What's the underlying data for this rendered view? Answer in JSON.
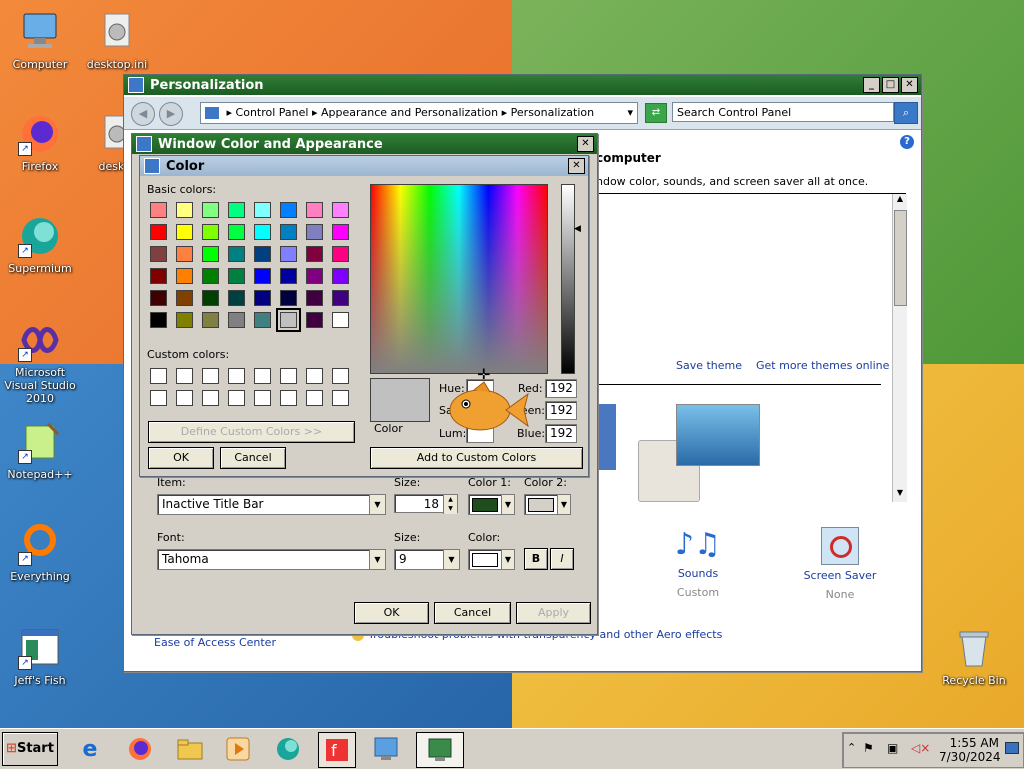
{
  "desktop": {
    "icons": [
      {
        "label": "Computer"
      },
      {
        "label": "desktop.ini"
      },
      {
        "label": "Firefox"
      },
      {
        "label": "deskto"
      },
      {
        "label": "Supermium"
      },
      {
        "label": "Microsoft Visual Studio 2010"
      },
      {
        "label": "Notepad++"
      },
      {
        "label": "Everything"
      },
      {
        "label": "Jeff's Fish"
      },
      {
        "label": "Recycle Bin"
      }
    ]
  },
  "personalization": {
    "title": "Personalization",
    "breadcrumb": [
      "Control Panel",
      "Appearance and Personalization",
      "Personalization"
    ],
    "search_placeholder": "Search Control Panel",
    "heading": "computer",
    "subtext": "ndow color, sounds, and screen saver all at once.",
    "save_theme": "Save theme",
    "get_more_themes": "Get more themes online",
    "sounds_label": "Sounds",
    "sounds_value": "Custom",
    "screensaver_label": "Screen Saver",
    "screensaver_value": "None",
    "ease_of_access": "Ease of Access Center",
    "troubleshoot": "Troubleshoot problems with transparency and other Aero effects"
  },
  "wca": {
    "title": "Window Color and Appearance",
    "item_label": "Item:",
    "item_value": "Inactive Title Bar",
    "size_label": "Size:",
    "size_value": "18",
    "color1_label": "Color 1:",
    "color2_label": "Color 2:",
    "color1": "#1e4d1e",
    "color2": "#d4d0c8",
    "font_label": "Font:",
    "font_value": "Tahoma",
    "font_size_label": "Size:",
    "font_size_value": "9",
    "font_color_label": "Color:",
    "font_color": "#ffffff",
    "bold_label": "B",
    "italic_label": "I",
    "ok": "OK",
    "cancel": "Cancel",
    "apply": "Apply"
  },
  "color_dialog": {
    "title": "Color",
    "basic_colors_label": "Basic colors:",
    "custom_colors_label": "Custom colors:",
    "define_custom": "Define Custom Colors >>",
    "ok": "OK",
    "cancel": "Cancel",
    "add_custom": "Add to Custom Colors",
    "color_solid_label": "Color",
    "hue_label": "Hue:",
    "sat_label": "Sat:",
    "lum_label": "Lum:",
    "red_label": "Red:",
    "green_label": "Green:",
    "blue_label": "Blue:",
    "red_value": "192",
    "green_value": "192",
    "blue_value": "192",
    "selected_color": "#c0c0c0",
    "basic_colors": [
      "#ff8080",
      "#ffff80",
      "#80ff80",
      "#00ff80",
      "#80ffff",
      "#0080ff",
      "#ff80c0",
      "#ff80ff",
      "#ff0000",
      "#ffff00",
      "#80ff00",
      "#00ff40",
      "#00ffff",
      "#0080c0",
      "#8080c0",
      "#ff00ff",
      "#804040",
      "#ff8040",
      "#00ff00",
      "#008080",
      "#004080",
      "#8080ff",
      "#800040",
      "#ff0080",
      "#800000",
      "#ff8000",
      "#008000",
      "#008040",
      "#0000ff",
      "#0000a0",
      "#800080",
      "#8000ff",
      "#400000",
      "#804000",
      "#004000",
      "#004040",
      "#000080",
      "#000040",
      "#400040",
      "#400080",
      "#000000",
      "#808000",
      "#808040",
      "#808080",
      "#408080",
      "#c0c0c0",
      "#400040",
      "#ffffff"
    ]
  },
  "taskbar": {
    "start_label": "Start",
    "time": "1:55 AM",
    "date": "7/30/2024"
  }
}
